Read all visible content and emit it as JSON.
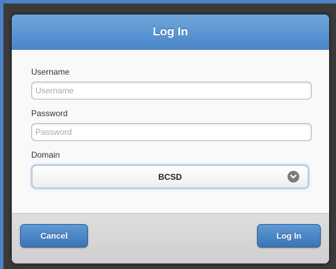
{
  "dialog": {
    "title": "Log In"
  },
  "form": {
    "username": {
      "label": "Username",
      "placeholder": "Username",
      "value": ""
    },
    "password": {
      "label": "Password",
      "placeholder": "Password",
      "value": ""
    },
    "domain": {
      "label": "Domain",
      "selected": "BCSD",
      "icon": "chevron-down-circle-icon"
    }
  },
  "footer": {
    "cancel_label": "Cancel",
    "login_label": "Log In"
  },
  "colors": {
    "header": "#4a87c9",
    "button": "#3a74b6",
    "background": "#4d80c4"
  }
}
